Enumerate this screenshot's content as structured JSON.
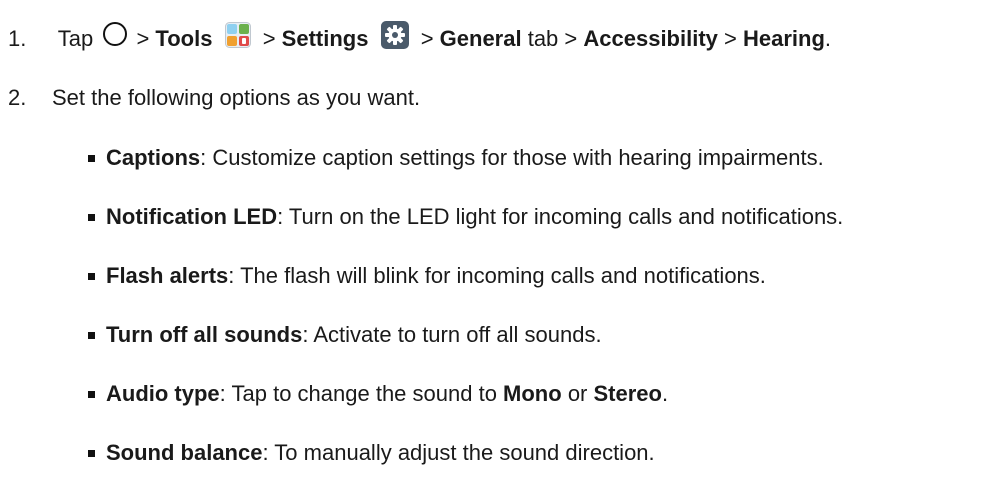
{
  "step1": {
    "number": "1.",
    "text_tap": "Tap",
    "sep1": ">",
    "tools": "Tools",
    "sep2": ">",
    "settings": "Settings",
    "sep3": ">",
    "general": "General",
    "text_tab": "tab",
    "sep4": ">",
    "accessibility": "Accessibility",
    "sep5": ">",
    "hearing": "Hearing",
    "end": ".",
    "icons": [
      "home-circle-icon",
      "tools-folder-icon",
      "settings-gear-icon"
    ]
  },
  "step2": {
    "number": "2.",
    "text": "Set the following options as you want."
  },
  "options": [
    {
      "term": "Captions",
      "desc": ": Customize caption settings for those with hearing impairments."
    },
    {
      "term": "Notification LED",
      "desc": ": Turn on the LED light for incoming calls and notifications."
    },
    {
      "term": "Flash alerts",
      "desc": ": The flash will blink for incoming calls and notifications."
    },
    {
      "term": "Turn off all sounds",
      "desc": ": Activate to turn off all sounds."
    },
    {
      "term": "Audio type",
      "desc_a": ": Tap to change the sound to ",
      "mono": "Mono",
      "or": " or ",
      "stereo": "Stereo",
      "end": "."
    },
    {
      "term": "Sound balance",
      "desc": ": To manually adjust the sound direction."
    }
  ],
  "colors": {
    "text": "#1a1a1a",
    "tools_icon_tiles": [
      "#8fd0f0",
      "#f0a030",
      "#e04a4a",
      "#6ab04c"
    ],
    "settings_icon_bg": "#4a5a6a"
  }
}
